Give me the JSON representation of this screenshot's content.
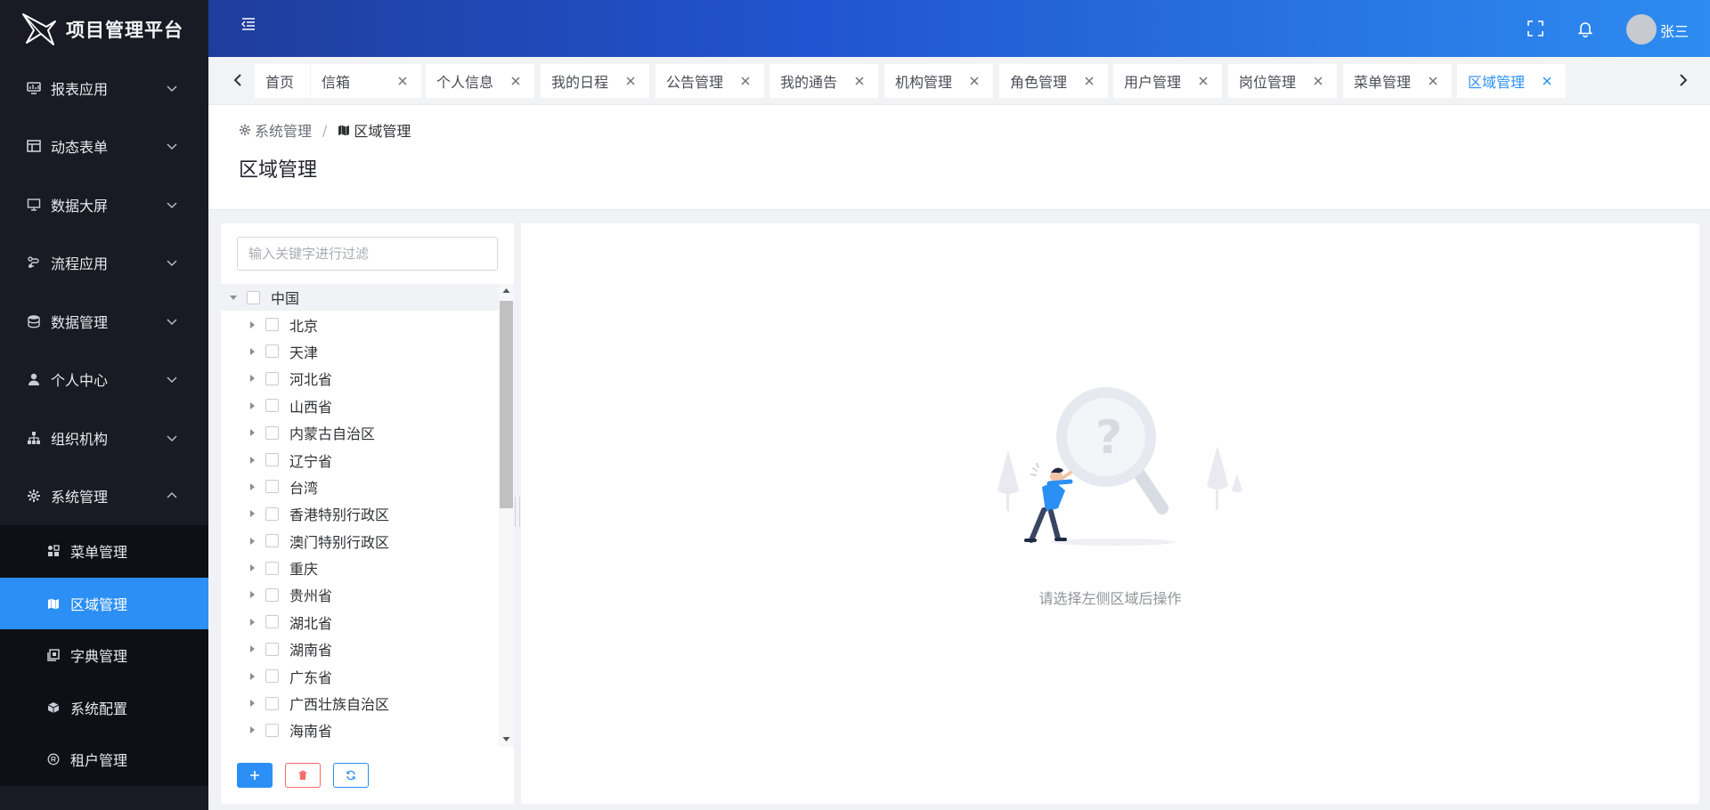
{
  "app": {
    "title": "项目管理平台"
  },
  "sidebar": {
    "items": [
      {
        "label": "报表应用",
        "icon": "chart-board-icon"
      },
      {
        "label": "动态表单",
        "icon": "table-layout-icon"
      },
      {
        "label": "数据大屏",
        "icon": "monitor-icon"
      },
      {
        "label": "流程应用",
        "icon": "flow-icon"
      },
      {
        "label": "数据管理",
        "icon": "database-icon"
      },
      {
        "label": "个人中心",
        "icon": "user-icon"
      },
      {
        "label": "组织机构",
        "icon": "org-tree-icon"
      },
      {
        "label": "系统管理",
        "icon": "gear-icon"
      }
    ],
    "sub_items": [
      {
        "label": "菜单管理",
        "icon": "menu-grid-icon"
      },
      {
        "label": "区域管理",
        "icon": "map-icon",
        "active": true
      },
      {
        "label": "字典管理",
        "icon": "dictionary-icon"
      },
      {
        "label": "系统配置",
        "icon": "cube-icon"
      },
      {
        "label": "租户管理",
        "icon": "tenant-icon"
      }
    ]
  },
  "header": {
    "username": "张三"
  },
  "tabs": [
    {
      "label": "首页",
      "closable": false
    },
    {
      "label": "信箱",
      "closable": true
    },
    {
      "label": "个人信息",
      "closable": true
    },
    {
      "label": "我的日程",
      "closable": true
    },
    {
      "label": "公告管理",
      "closable": true
    },
    {
      "label": "我的通告",
      "closable": true
    },
    {
      "label": "机构管理",
      "closable": true
    },
    {
      "label": "角色管理",
      "closable": true
    },
    {
      "label": "用户管理",
      "closable": true
    },
    {
      "label": "岗位管理",
      "closable": true
    },
    {
      "label": "菜单管理",
      "closable": true
    },
    {
      "label": "区域管理",
      "closable": true,
      "active": true
    }
  ],
  "breadcrumb": {
    "parent": "系统管理",
    "current": "区域管理",
    "separator": "/"
  },
  "page": {
    "title": "区域管理"
  },
  "filter": {
    "placeholder": "输入关键字进行过滤",
    "value": ""
  },
  "tree": {
    "root": "中国",
    "children": [
      "北京",
      "天津",
      "河北省",
      "山西省",
      "内蒙古自治区",
      "辽宁省",
      "台湾",
      "香港特别行政区",
      "澳门特别行政区",
      "重庆",
      "贵州省",
      "湖北省",
      "湖南省",
      "广东省",
      "广西壮族自治区",
      "海南省"
    ]
  },
  "empty_state": {
    "message": "请选择左侧区域后操作"
  },
  "colors": {
    "accent": "#2b8ff5",
    "sidebar_bg": "#191a23",
    "danger": "#f56c6c"
  }
}
